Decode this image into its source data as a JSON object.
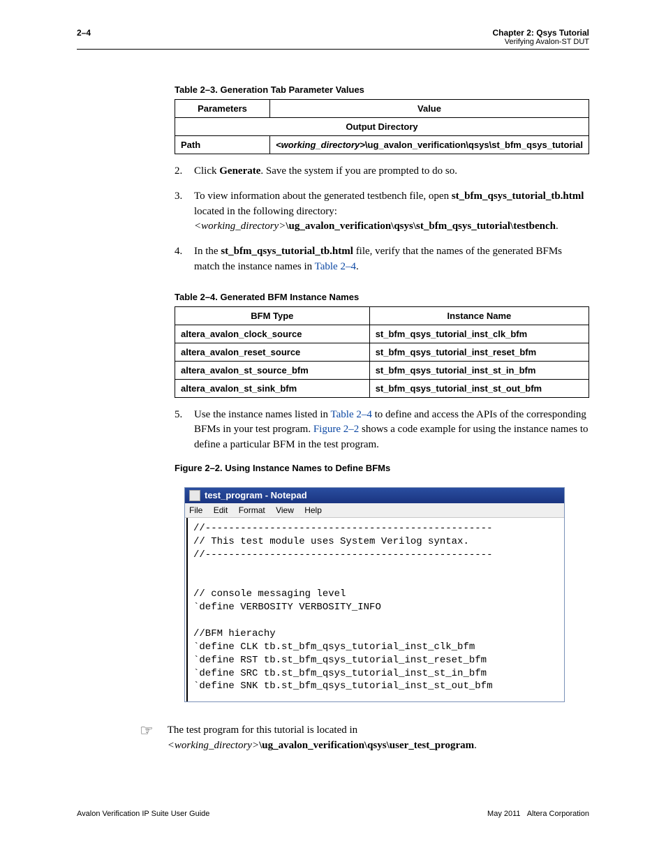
{
  "header": {
    "page_number": "2–4",
    "chapter": "Chapter 2: Qsys Tutorial",
    "section": "Verifying Avalon-ST DUT"
  },
  "table1": {
    "caption": "Table 2–3.  Generation Tab Parameter Values",
    "headers": {
      "col1": "Parameters",
      "col2": "Value"
    },
    "section": "Output Directory",
    "rows": [
      {
        "param": "Path",
        "value_pre": "<working_directory>",
        "value_post": "\\ug_avalon_verification\\qsys\\st_bfm_qsys_tutorial"
      }
    ]
  },
  "steps": {
    "s2": {
      "num": "2.",
      "a": "Click ",
      "b": "Generate",
      "c": ". Save the system if you are prompted to do so."
    },
    "s3": {
      "num": "3.",
      "a": "To view information about the generated testbench file, open ",
      "b": "st_bfm_qsys_tutorial_tb.html",
      "c": " located in the following directory: ",
      "d": "<working_directory>",
      "e": "\\ug_avalon_verification\\qsys\\st_bfm_qsys_tutorial\\testbench",
      "f": "."
    },
    "s4": {
      "num": "4.",
      "a": "In the ",
      "b": "st_bfm_qsys_tutorial_tb.html",
      "c": " file, verify that the names of the generated BFMs match the instance names in ",
      "d": "Table 2–4",
      "e": "."
    },
    "s5": {
      "num": "5.",
      "a": "Use the instance names listed in ",
      "b": "Table 2–4",
      "c": " to define and access the APIs of the corresponding BFMs in your test program. ",
      "d": "Figure 2–2",
      "e": " shows a code example for using the instance names to define a particular BFM in the test program."
    }
  },
  "table2": {
    "caption": "Table 2–4.  Generated BFM Instance Names",
    "headers": {
      "col1": "BFM Type",
      "col2": "Instance Name"
    },
    "rows": [
      {
        "c1": "altera_avalon_clock_source",
        "c2": "st_bfm_qsys_tutorial_inst_clk_bfm"
      },
      {
        "c1": "altera_avalon_reset_source",
        "c2": "st_bfm_qsys_tutorial_inst_reset_bfm"
      },
      {
        "c1": "altera_avalon_st_source_bfm",
        "c2": "st_bfm_qsys_tutorial_inst_st_in_bfm"
      },
      {
        "c1": "altera_avalon_st_sink_bfm",
        "c2": "st_bfm_qsys_tutorial_inst_st_out_bfm"
      }
    ]
  },
  "figure": {
    "caption": "Figure 2–2.  Using Instance Names to Define BFMs",
    "notepad_title": "test_program - Notepad",
    "menu": {
      "file": "File",
      "edit": "Edit",
      "format": "Format",
      "view": "View",
      "help": "Help"
    },
    "code": "//-------------------------------------------------\n// This test module uses System Verilog syntax.\n//-------------------------------------------------\n\n\n// console messaging level\n`define VERBOSITY VERBOSITY_INFO\n\n//BFM hierachy\n`define CLK tb.st_bfm_qsys_tutorial_inst_clk_bfm\n`define RST tb.st_bfm_qsys_tutorial_inst_reset_bfm\n`define SRC tb.st_bfm_qsys_tutorial_inst_st_in_bfm\n`define SNK tb.st_bfm_qsys_tutorial_inst_st_out_bfm"
  },
  "note": {
    "a": "The test program for this tutorial is located in ",
    "b": "<working_directory>",
    "c": "\\ug_avalon_verification\\qsys\\user_test_program",
    "d": "."
  },
  "footer": {
    "left": "Avalon Verification IP Suite User Guide",
    "right_a": "May 2011",
    "right_b": "Altera Corporation"
  }
}
